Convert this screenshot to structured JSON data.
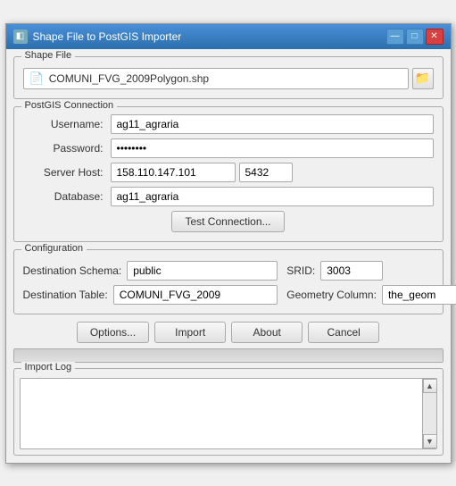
{
  "window": {
    "title": "Shape File to PostGIS Importer",
    "icon": "◧",
    "controls": {
      "minimize": "—",
      "maximize": "□",
      "close": "✕"
    }
  },
  "shapefile": {
    "group_label": "Shape File",
    "path": "COMUNI_FVG_2009Polygon.shp",
    "browse_icon": "📁"
  },
  "postgis": {
    "group_label": "PostGIS Connection",
    "username_label": "Username:",
    "username_value": "ag11_agraria",
    "password_label": "Password:",
    "password_value": "••••••••",
    "server_host_label": "Server Host:",
    "server_host_value": "158.110.147.101",
    "port_value": "5432",
    "database_label": "Database:",
    "database_value": "ag11_agraria",
    "test_button": "Test Connection..."
  },
  "configuration": {
    "group_label": "Configuration",
    "dest_schema_label": "Destination Schema:",
    "dest_schema_value": "public",
    "srid_label": "SRID:",
    "srid_value": "3003",
    "dest_table_label": "Destination Table:",
    "dest_table_value": "COMUNI_FVG_2009",
    "geom_column_label": "Geometry Column:",
    "geom_column_value": "the_geom"
  },
  "actions": {
    "options_button": "Options...",
    "import_button": "Import",
    "about_button": "About",
    "cancel_button": "Cancel"
  },
  "import_log": {
    "group_label": "Import Log"
  }
}
